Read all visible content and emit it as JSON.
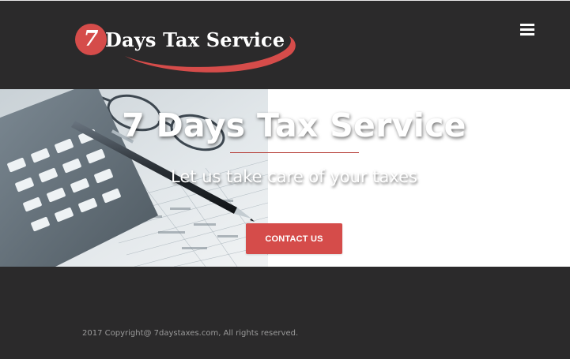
{
  "header": {
    "logo": {
      "number": "7",
      "text": "Days Tax Service"
    },
    "menu_icon": "hamburger-menu-icon"
  },
  "hero": {
    "title": "7 Days Tax Service",
    "subtitle": "Let us take care of your taxes",
    "contact_button_label": "CONTACT US",
    "image": "calculator-pen-glasses-photo"
  },
  "footer": {
    "copyright": "2017 Copyright@ 7daystaxes.com, All rights reserved."
  },
  "colors": {
    "background": "#2b2a2b",
    "accent": "#d54c4a",
    "hero_background": "#ffffff",
    "divider": "#b43b35",
    "footer_text": "#9a9a9a"
  }
}
